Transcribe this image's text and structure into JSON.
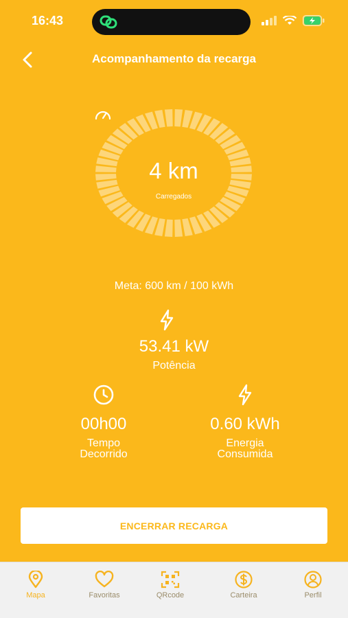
{
  "status_bar": {
    "time": "16:43"
  },
  "header": {
    "title": "Acompanhamento da recarga"
  },
  "gauge": {
    "value": "4 km",
    "caption": "Carregados",
    "progress": 0.007
  },
  "goal": {
    "text": "Meta: 600 km / 100 kWh"
  },
  "power": {
    "value": "53.41 kW",
    "label": "Potência"
  },
  "stats": {
    "elapsed": {
      "value": "00h00",
      "label_line1": "Tempo",
      "label_line2": "Decorrido"
    },
    "energy": {
      "value": "0.60 kWh",
      "label_line1": "Energia",
      "label_line2": "Consumida"
    }
  },
  "actions": {
    "end_label": "ENCERRAR RECARGA"
  },
  "tabs": [
    {
      "label": "Mapa",
      "icon": "map-pin-icon",
      "active": true
    },
    {
      "label": "Favoritas",
      "icon": "heart-icon",
      "active": false
    },
    {
      "label": "QRcode",
      "icon": "qrcode-icon",
      "active": false
    },
    {
      "label": "Carteira",
      "icon": "dollar-icon",
      "active": false
    },
    {
      "label": "Perfil",
      "icon": "user-icon",
      "active": false
    }
  ],
  "colors": {
    "background": "#fbb81b",
    "white": "#ffffff",
    "tab_bar": "#f1f1f1"
  }
}
